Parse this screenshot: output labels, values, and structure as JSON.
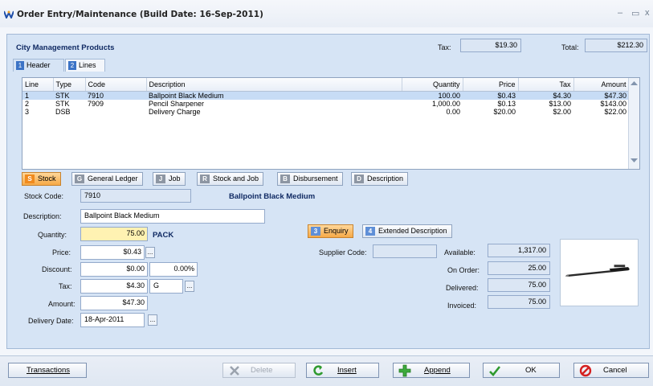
{
  "window": {
    "title": "Order Entry/Maintenance (Build Date: 16-Sep-2011)"
  },
  "header": {
    "company": "City Management Products",
    "tax_label": "Tax:",
    "tax_value": "$19.30",
    "total_label": "Total:",
    "total_value": "$212.30"
  },
  "tabs": [
    {
      "num": "1",
      "label": "Header"
    },
    {
      "num": "2",
      "label": "Lines"
    }
  ],
  "grid": {
    "columns": [
      "Line",
      "Type",
      "Code",
      "Description",
      "Quantity",
      "Price",
      "Tax",
      "Amount"
    ],
    "rows": [
      [
        "1",
        "STK",
        "7910",
        "Ballpoint Black Medium",
        "100.00",
        "$0.43",
        "$4.30",
        "$47.30"
      ],
      [
        "2",
        "STK",
        "7909",
        "Pencil Sharpener",
        "1,000.00",
        "$0.13",
        "$13.00",
        "$143.00"
      ],
      [
        "3",
        "DSB",
        "",
        "Delivery Charge",
        "0.00",
        "$20.00",
        "$2.00",
        "$22.00"
      ]
    ]
  },
  "line_buttons": [
    {
      "badge": "S",
      "label": "Stock"
    },
    {
      "badge": "G",
      "label": "General Ledger"
    },
    {
      "badge": "J",
      "label": "Job"
    },
    {
      "badge": "R",
      "label": "Stock and Job"
    },
    {
      "badge": "B",
      "label": "Disbursement"
    },
    {
      "badge": "D",
      "label": "Description"
    }
  ],
  "form": {
    "stock_code_label": "Stock Code:",
    "stock_code": "7910",
    "stock_name": "Ballpoint Black Medium",
    "description_label": "Description:",
    "description": "Ballpoint Black Medium",
    "quantity_label": "Quantity:",
    "quantity": "75.00",
    "unit": "PACK",
    "price_label": "Price:",
    "price": "$0.43",
    "discount_label": "Discount:",
    "discount": "$0.00",
    "discount_pct": "0.00%",
    "tax_label": "Tax:",
    "tax": "$4.30",
    "tax_code": "G",
    "amount_label": "Amount:",
    "amount": "$47.30",
    "delivery_label": "Delivery Date:",
    "delivery_date": "18-Apr-2011",
    "ellipsis": "..."
  },
  "stock_buttons": [
    {
      "badge": "3",
      "label": "Enquiry"
    },
    {
      "badge": "4",
      "label": "Extended Description"
    }
  ],
  "stock_info": {
    "supplier_code_label": "Supplier Code:",
    "supplier_code": "",
    "available_label": "Available:",
    "available": "1,317.00",
    "on_order_label": "On Order:",
    "on_order": "25.00",
    "delivered_label": "Delivered:",
    "delivered": "75.00",
    "invoiced_label": "Invoiced:",
    "invoiced": "75.00"
  },
  "footer": {
    "transactions": "Transactions",
    "delete": "Delete",
    "insert": "Insert",
    "append": "Append",
    "ok": "OK",
    "cancel": "Cancel"
  }
}
